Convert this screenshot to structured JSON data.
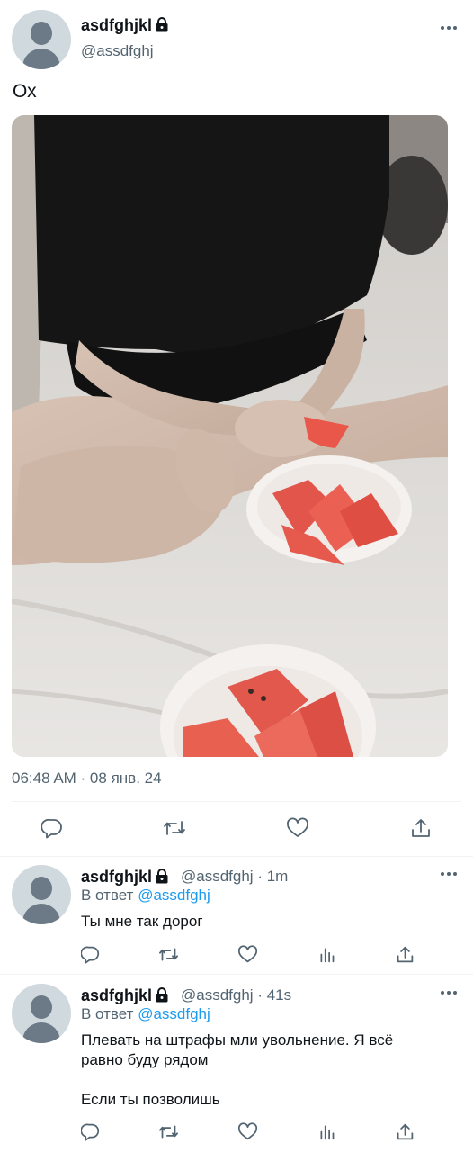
{
  "main_tweet": {
    "display_name": "asdfghjkl",
    "handle": "@assdfghj",
    "text": "Ох",
    "timestamp": "06:48 AM · 08 янв. 24",
    "photo_alt": "Photo: person sitting cross-legged on a bed holding a piece of watermelon, two bowls of watermelon slices",
    "actions": [
      "reply-icon",
      "retweet-icon",
      "like-icon",
      "share-icon"
    ]
  },
  "replies": [
    {
      "display_name": "asdfghjkl",
      "handle": "@assdfghj",
      "separator": "·",
      "time": "1m",
      "reply_prefix": "В ответ",
      "reply_to": "@assdfghj",
      "lines": [
        "Ты мне так дорог"
      ]
    },
    {
      "display_name": "asdfghjkl",
      "handle": "@assdfghj",
      "separator": "·",
      "time": "41s",
      "reply_prefix": "В ответ",
      "reply_to": "@assdfghj",
      "lines": [
        "Плевать на штрафы мли увольнение. Я всё",
        "равно буду рядом",
        "",
        "Если ты позволишь"
      ]
    }
  ],
  "colors": {
    "accent": "#1d9bf0",
    "secondary_text": "#536471",
    "divider": "#eff3f4"
  }
}
